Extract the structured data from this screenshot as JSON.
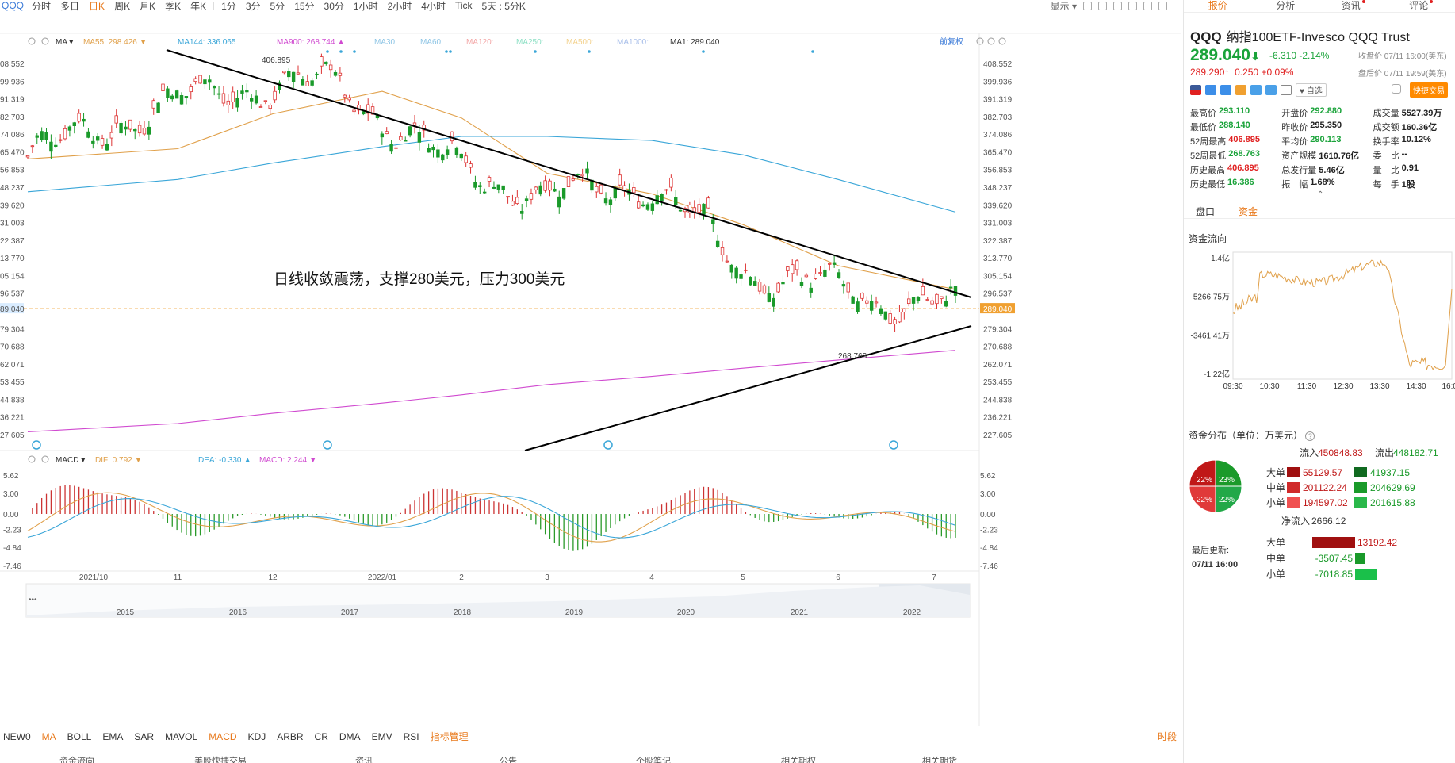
{
  "toolbar": {
    "symbol": "QQQ",
    "timeframes": [
      "分时",
      "多日",
      "日K",
      "周K",
      "月K",
      "季K",
      "年K",
      "1分",
      "3分",
      "5分",
      "15分",
      "30分",
      "1小时",
      "2小时",
      "4小时",
      "Tick",
      "5天 : 5分K"
    ],
    "active": "日K",
    "display_label": "显示"
  },
  "ma_legend": [
    {
      "label": "MA55: 298.426",
      "color": "#e0a04a",
      "arrow": "▼"
    },
    {
      "label": "MA144: 336.065",
      "color": "#3aa6d8",
      "arrow": ""
    },
    {
      "label": "MA900: 268.744",
      "color": "#d04ad0",
      "arrow": "▲"
    },
    {
      "label": "MA30:",
      "color": "#8ec5e5",
      "arrow": ""
    },
    {
      "label": "MA60:",
      "color": "#8ec5e5",
      "arrow": ""
    },
    {
      "label": "MA120:",
      "color": "#f3a6a6",
      "arrow": ""
    },
    {
      "label": "MA250:",
      "color": "#8ee0c5",
      "arrow": ""
    },
    {
      "label": "MA500:",
      "color": "#f3d28e",
      "arrow": ""
    },
    {
      "label": "MA1000:",
      "color": "#aac0ea",
      "arrow": ""
    },
    {
      "label": "MA1: 289.040",
      "color": "#333333",
      "arrow": ""
    }
  ],
  "ma_type_label": "MA",
  "adjust_label": "前复权",
  "annotation": "日线收敛震荡，支撑280美元，压力300美元",
  "high_label": "406.895",
  "low_label": "268.763",
  "current_price_label": "289.040",
  "right_axis": [
    "408.552",
    "399.936",
    "391.319",
    "382.703",
    "374.086",
    "365.470",
    "356.853",
    "348.237",
    "339.620",
    "331.003",
    "322.387",
    "313.770",
    "305.154",
    "296.537",
    "289.040",
    "279.304",
    "270.688",
    "262.071",
    "253.455",
    "244.838",
    "236.221",
    "227.605"
  ],
  "left_axis": [
    "08.552",
    "99.936",
    "91.319",
    "82.703",
    "74.086",
    "65.470",
    "56.853",
    "48.237",
    "39.620",
    "31.003",
    "22.387",
    "13.770",
    "05.154",
    "96.537",
    "89.040",
    "79.304",
    "70.688",
    "62.071",
    "53.455",
    "44.838",
    "36.221",
    "27.605"
  ],
  "macd": {
    "label": "MACD",
    "dif": "DIF: 0.792",
    "dea": "DEA: -0.330",
    "macd": "MACD: 2.244",
    "axis": [
      "5.62",
      "3.00",
      "0.00",
      "-2.23",
      "-4.84",
      "-7.46"
    ]
  },
  "x_axis_months": [
    "2021/10",
    "11",
    "12",
    "2022/01",
    "2",
    "3",
    "4",
    "5",
    "6",
    "7"
  ],
  "overview_years": [
    "2015",
    "2016",
    "2017",
    "2018",
    "2019",
    "2020",
    "2021",
    "2022"
  ],
  "indicators": [
    "NEW0",
    "MA",
    "BOLL",
    "EMA",
    "SAR",
    "MAVOL",
    "MACD",
    "KDJ",
    "ARBR",
    "CR",
    "DMA",
    "EMV",
    "RSI"
  ],
  "active_indicators": [
    "MA",
    "MACD"
  ],
  "indicator_manager": "指标管理",
  "shi_label": "时段",
  "bottom_tabs": [
    "资金流向",
    "美股快捷交易",
    "资讯",
    "公告",
    "个股笔记",
    "相关期权",
    "相关期货"
  ],
  "right_panel": {
    "tabs": [
      "报价",
      "分析",
      "资讯",
      "评论"
    ],
    "symbol": "QQQ",
    "name": "纳指100ETF-Invesco QQQ Trust",
    "price": "289.040",
    "arrow": "⬇",
    "change": "-6.310",
    "change_pct": "-2.14%",
    "close_time": "收盘价 07/11 16:00(美东)",
    "ah_price": "289.290",
    "ah_arrow": "↑",
    "ah_change": "0.250",
    "ah_pct": "+0.09%",
    "ah_time": "盘后价 07/11 19:59(美东)",
    "watch_label": "自选",
    "fast_trade": "快捷交易",
    "stats": [
      [
        {
          "l": "最高价",
          "v": "293.110",
          "c": "grn"
        },
        {
          "l": "开盘价",
          "v": "292.880",
          "c": "grn"
        },
        {
          "l": "成交量",
          "v": "5527.39万",
          "c": "blk"
        }
      ],
      [
        {
          "l": "最低价",
          "v": "288.140",
          "c": "grn"
        },
        {
          "l": "昨收价",
          "v": "295.350",
          "c": "blk"
        },
        {
          "l": "成交额",
          "v": "160.36亿",
          "c": "blk"
        }
      ],
      [
        {
          "l": "52周最高",
          "v": "406.895",
          "c": "red"
        },
        {
          "l": "平均价",
          "v": "290.113",
          "c": "grn"
        },
        {
          "l": "换手率",
          "v": "10.12%",
          "c": "blk"
        }
      ],
      [
        {
          "l": "52周最低",
          "v": "268.763",
          "c": "grn"
        },
        {
          "l": "资产规模",
          "v": "1610.76亿",
          "c": "blk"
        },
        {
          "l": "委　比",
          "v": "--",
          "c": "blk"
        }
      ],
      [
        {
          "l": "历史最高",
          "v": "406.895",
          "c": "red"
        },
        {
          "l": "总发行量",
          "v": "5.46亿",
          "c": "blk"
        },
        {
          "l": "量　比",
          "v": "0.91",
          "c": "blk"
        }
      ],
      [
        {
          "l": "历史最低",
          "v": "16.386",
          "c": "grn"
        },
        {
          "l": "振　幅",
          "v": "1.68%",
          "c": "blk"
        },
        {
          "l": "每　手",
          "v": "1股",
          "c": "blk"
        }
      ]
    ],
    "subtabs": [
      "盘口",
      "资金"
    ],
    "subtab_active": "资金",
    "flow_title": "资金流向",
    "flow_y": [
      "1.4亿",
      "5266.75万",
      "-3461.41万",
      "-1.22亿"
    ],
    "flow_x": [
      "09:30",
      "10:30",
      "11:30",
      "12:30",
      "13:30",
      "14:30",
      "16:00"
    ],
    "dist_title": "资金分布（单位：万美元）",
    "pie_pcts": [
      "22%",
      "23%",
      "22%",
      "22%"
    ],
    "inflow_label": "流入",
    "inflow": "450848.83",
    "outflow_label": "流出",
    "outflow": "448182.71",
    "sizes": [
      "大单",
      "中单",
      "小单"
    ],
    "in_vals": [
      "55129.57",
      "201122.24",
      "194597.02"
    ],
    "out_vals": [
      "41937.15",
      "204629.69",
      "201615.88"
    ],
    "net_label": "净流入",
    "net_total": "2666.12",
    "net_vals": [
      "13192.42",
      "-3507.45",
      "-7018.85"
    ],
    "last_update_label": "最后更新:",
    "last_update": "07/11 16:00"
  },
  "chart_data": {
    "type": "line",
    "title": "",
    "x": [
      "2021/10",
      "11",
      "12",
      "2022/01",
      "2",
      "3",
      "4",
      "5",
      "6",
      "7"
    ],
    "series": [
      {
        "name": "MA55",
        "values": [
          362,
          367,
          384,
          395,
          382,
          355,
          345,
          330,
          310,
          298.4
        ]
      },
      {
        "name": "MA144",
        "values": [
          346,
          352,
          360,
          368,
          373,
          373,
          371,
          364,
          352,
          336.1
        ]
      },
      {
        "name": "MA900",
        "values": [
          229,
          233,
          238,
          243,
          247,
          252,
          256,
          260,
          264,
          268.7
        ]
      },
      {
        "name": "MA1",
        "values": [
          363,
          383,
          397,
          398,
          363,
          343,
          351,
          307,
          296,
          289
        ]
      }
    ],
    "ylim": [
      227.605,
      408.552
    ],
    "yticks": [
      408.552,
      399.936,
      391.319,
      382.703,
      374.086,
      365.47,
      356.853,
      348.237,
      339.62,
      331.003,
      322.387,
      313.77,
      305.154,
      296.537,
      289.04,
      279.304,
      270.688,
      262.071,
      253.455,
      244.838,
      236.221,
      227.605
    ]
  }
}
